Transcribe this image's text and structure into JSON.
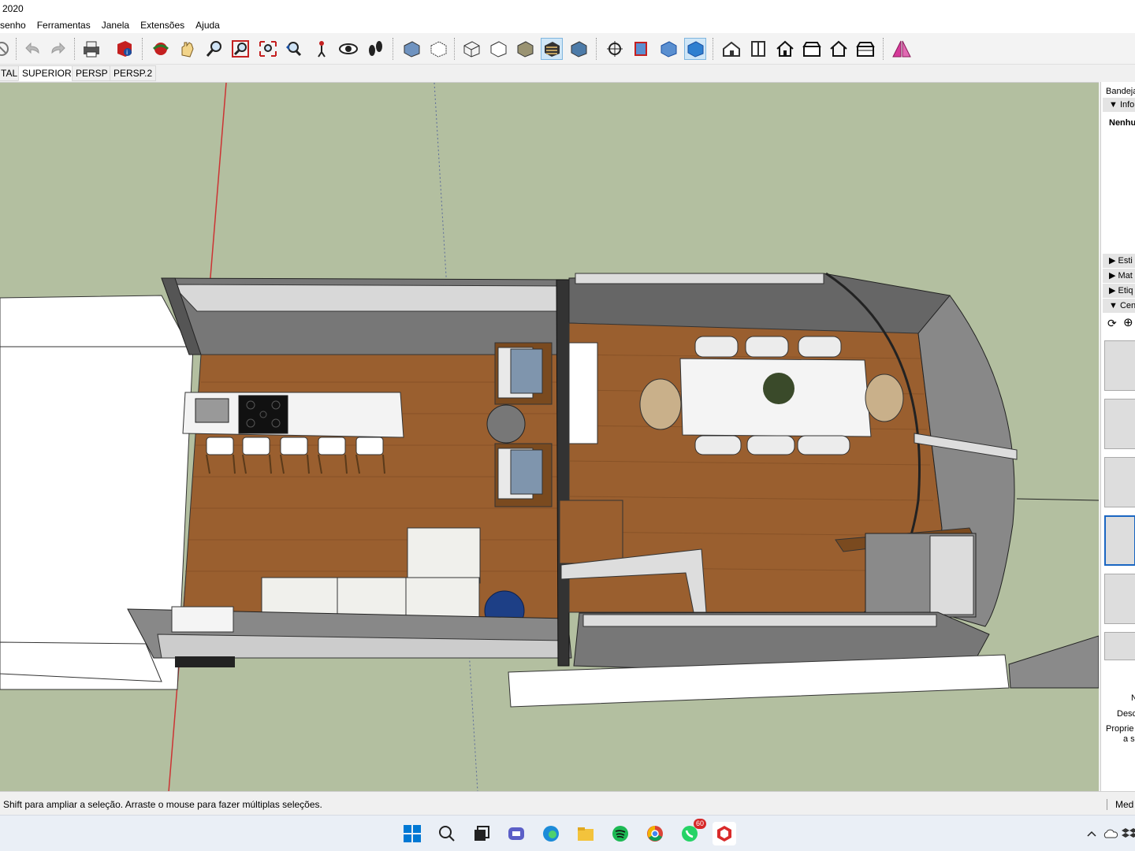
{
  "titlebar": {
    "title": "2020"
  },
  "menu": {
    "items": [
      "senho",
      "Ferramentas",
      "Janela",
      "Extensões",
      "Ajuda"
    ]
  },
  "toolbar": {
    "icons": [
      "select-icon",
      "undo-icon",
      "redo-icon",
      "print-icon",
      "model-info-icon",
      "orbit-icon",
      "pan-icon",
      "zoom-icon",
      "zoom-window-icon",
      "zoom-extents-icon",
      "previous-view-icon",
      "position-camera-icon",
      "look-around-icon",
      "walk-icon",
      "xray-icon",
      "back-edges-icon",
      "wireframe-icon",
      "hidden-line-icon",
      "shaded-icon",
      "shaded-textures-icon",
      "monochrome-icon",
      "section-plane-icon",
      "display-section-planes-icon",
      "display-section-cuts-icon",
      "display-section-fill-icon",
      "iso-view-icon",
      "top-view-icon",
      "front-view-icon",
      "right-view-icon",
      "back-view-icon",
      "left-view-icon",
      "mirror-icon"
    ],
    "active": [
      "shaded-textures-icon",
      "display-section-fill-icon"
    ]
  },
  "scenes": {
    "tabs": [
      "TAL",
      "SUPERIOR",
      "PERSP",
      "PERSP.2"
    ],
    "selected": "SUPERIOR"
  },
  "tray": {
    "title": "Bandeja",
    "info_panel": "Info",
    "info_value": "Nenhu",
    "panels": [
      "Esti",
      "Mat",
      "Etiq",
      "Cen"
    ],
    "scene_labels": {
      "name": "N",
      "desc": "Desc",
      "props": "Proprie",
      "props2": "a sa"
    }
  },
  "status": {
    "message": "Shift para ampliar a seleção. Arraste o mouse para fazer múltiplas seleções.",
    "measure_label": "Med"
  },
  "taskbar": {
    "icons": [
      "windows-start-icon",
      "search-icon",
      "task-view-icon",
      "teams-chat-icon",
      "edge-icon",
      "file-explorer-icon",
      "spotify-icon",
      "chrome-icon",
      "whatsapp-icon",
      "sketchup-icon"
    ],
    "whatsapp_badge": "60",
    "tray_icons": [
      "chevron-up-icon",
      "cloud-icon",
      "dropbox-icon"
    ]
  },
  "colors": {
    "viewport_bg": "#b3bfa0",
    "floor_wood": "#9a5f2f",
    "accent_blue": "#1a66c2",
    "axis_red": "#cc3333"
  }
}
